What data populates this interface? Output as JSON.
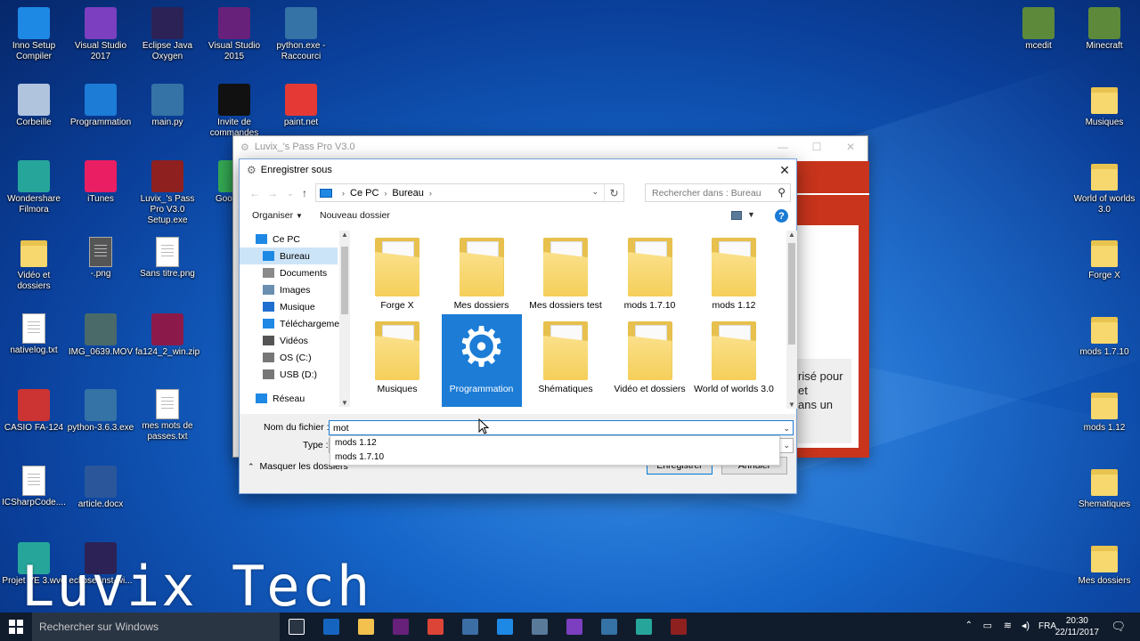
{
  "desktop": {
    "icons": [
      {
        "label": "Inno Setup Compiler",
        "icon": "inno-setup-icon",
        "color": "#1e88e5"
      },
      {
        "label": "Visual Studio 2017",
        "icon": "visual-studio-icon",
        "color": "#7b3fbf"
      },
      {
        "label": "Eclipse Java Oxygen",
        "icon": "eclipse-icon",
        "color": "#2c2255"
      },
      {
        "label": "Visual Studio 2015",
        "icon": "visual-studio-icon",
        "color": "#68217a"
      },
      {
        "label": "python.exe - Raccourci",
        "icon": "python-icon",
        "color": "#3572a5"
      },
      {
        "label": "Corbeille",
        "icon": "recycle-bin-icon",
        "color": "#b0c4de"
      },
      {
        "label": "Programmation",
        "icon": "gear-icon",
        "color": "#1c7cd6"
      },
      {
        "label": "main.py",
        "icon": "python-file-icon",
        "color": "#3572a5"
      },
      {
        "label": "Invite de commandes",
        "icon": "terminal-icon",
        "color": "#111111"
      },
      {
        "label": "paint.net",
        "icon": "paint-icon",
        "color": "#e53935"
      },
      {
        "label": "Wondershare Filmora",
        "icon": "filmora-icon",
        "color": "#26a69a"
      },
      {
        "label": "iTunes",
        "icon": "itunes-icon",
        "color": "#e91e63"
      },
      {
        "label": "Luvix_'s Pass Pro V3.0 Setup.exe",
        "icon": "setup-gear-icon",
        "color": "#8e2020"
      },
      {
        "label": "Google C",
        "icon": "chrome-icon",
        "color": "#34a853"
      },
      {
        "label": "Vidéo et dossiers",
        "icon": "folder-icon",
        "color": "#f7d86e"
      },
      {
        "label": "-.png",
        "icon": "image-file-icon",
        "color": "#555555"
      },
      {
        "label": "Sans titre.png",
        "icon": "image-file-icon",
        "color": "#ffffff"
      },
      {
        "label": "nativelog.txt",
        "icon": "text-file-icon",
        "color": "#ffffff"
      },
      {
        "label": "IMG_0639.MOV",
        "icon": "video-file-icon",
        "color": "#4a6a6a"
      },
      {
        "label": "fa124_2_win.zip",
        "icon": "winrar-icon",
        "color": "#8b1a4a"
      },
      {
        "label": "CASIO FA-124",
        "icon": "casio-icon",
        "color": "#cc3333"
      },
      {
        "label": "python-3.6.3.exe",
        "icon": "python-installer-icon",
        "color": "#3572a5"
      },
      {
        "label": "mes mots de passes.txt",
        "icon": "text-file-icon",
        "color": "#ffffff"
      },
      {
        "label": "ICSharpCode....",
        "icon": "file-icon",
        "color": "#ffffff"
      },
      {
        "label": "article.docx",
        "icon": "word-icon",
        "color": "#2b579a"
      },
      {
        "label": "Projet VE 3.wve",
        "icon": "filmora-project-icon",
        "color": "#26a69a"
      },
      {
        "label": "eclipse-inst-wi...",
        "icon": "eclipse-installer-icon",
        "color": "#2c2255"
      },
      {
        "label": "mcedit",
        "icon": "mcedit-icon",
        "color": "#5d8a3a"
      },
      {
        "label": "Minecraft",
        "icon": "minecraft-icon",
        "color": "#5d8a3a"
      },
      {
        "label": "Musiques",
        "icon": "folder-icon",
        "color": "#f7d86e"
      },
      {
        "label": "World of worlds 3.0",
        "icon": "folder-icon",
        "color": "#f7d86e"
      },
      {
        "label": "Forge X",
        "icon": "folder-icon",
        "color": "#f7d86e"
      },
      {
        "label": "mods 1.7.10",
        "icon": "folder-icon",
        "color": "#f7d86e"
      },
      {
        "label": "mods 1.12",
        "icon": "folder-icon",
        "color": "#f7d86e"
      },
      {
        "label": "Shematiques",
        "icon": "folder-icon",
        "color": "#f7d86e"
      },
      {
        "label": "Mes dossiers",
        "icon": "folder-icon",
        "color": "#f7d86e"
      }
    ],
    "watermark": "Luvix Tech"
  },
  "bg_window": {
    "title": "Luvix_'s Pass Pro V3.0",
    "partial_text": [
      "risé pour",
      "et",
      "ans un"
    ],
    "accent": "#c8341c"
  },
  "dialog": {
    "title": "Enregistrer sous",
    "breadcrumb": [
      "Ce PC",
      "Bureau"
    ],
    "search_placeholder": "Rechercher dans : Bureau",
    "organize_label": "Organiser",
    "new_folder_label": "Nouveau dossier",
    "nav_items": [
      {
        "label": "Ce PC",
        "icon": "computer-icon",
        "level": 0
      },
      {
        "label": "Bureau",
        "icon": "desktop-icon",
        "level": 1,
        "selected": true
      },
      {
        "label": "Documents",
        "icon": "documents-icon",
        "level": 1
      },
      {
        "label": "Images",
        "icon": "images-icon",
        "level": 1
      },
      {
        "label": "Musique",
        "icon": "music-icon",
        "level": 1
      },
      {
        "label": "Téléchargement",
        "icon": "downloads-icon",
        "level": 1
      },
      {
        "label": "Vidéos",
        "icon": "videos-icon",
        "level": 1
      },
      {
        "label": "OS (C:)",
        "icon": "drive-icon",
        "level": 1
      },
      {
        "label": "USB (D:)",
        "icon": "usb-drive-icon",
        "level": 1
      },
      {
        "label": "Réseau",
        "icon": "network-icon",
        "level": 0
      }
    ],
    "files": [
      {
        "label": "Forge X",
        "type": "folder"
      },
      {
        "label": "Mes dossiers",
        "type": "folder"
      },
      {
        "label": "Mes dossiers test",
        "type": "folder"
      },
      {
        "label": "mods 1.7.10",
        "type": "folder"
      },
      {
        "label": "mods 1.12",
        "type": "folder"
      },
      {
        "label": "Musiques",
        "type": "folder"
      },
      {
        "label": "Programmation",
        "type": "shortcut",
        "selected": true
      },
      {
        "label": "Shématiques",
        "type": "folder"
      },
      {
        "label": "Vidéo et dossiers",
        "type": "folder"
      },
      {
        "label": "World of worlds 3.0",
        "type": "folder"
      }
    ],
    "filename_label": "Nom du fichier :",
    "filename_value": "mot",
    "type_label": "Type :",
    "autocomplete": [
      "mods 1.12",
      "mods 1.7.10"
    ],
    "save_label": "Enregistrer",
    "cancel_label": "Annuler",
    "hide_folders_label": "Masquer les dossiers"
  },
  "taskbar": {
    "search_placeholder": "Rechercher sur Windows",
    "language": "FRA",
    "time": "20:30",
    "date": "22/11/2017",
    "apps": [
      "task-view-icon",
      "store-icon",
      "file-explorer-icon",
      "visual-studio-icon",
      "chrome-icon",
      "app-icon",
      "edge-icon",
      "app-icon",
      "visual-studio-2017-icon",
      "python-icon",
      "filmora-icon",
      "luvix-pass-icon"
    ]
  }
}
